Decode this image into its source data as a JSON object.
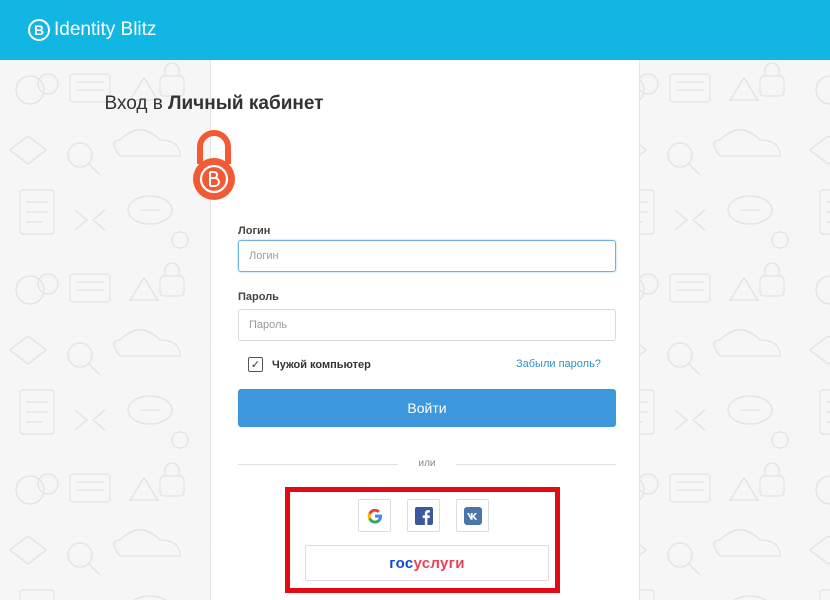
{
  "app": {
    "brand_mark": "B",
    "brand_name": "Identity Blitz"
  },
  "login": {
    "title_prefix": "Вход в",
    "title_bold": "Личный кабинет",
    "login_label": "Логин",
    "login_placeholder": "Логин",
    "password_label": "Пароль",
    "password_placeholder": "Пароль",
    "remember_label": "Чужой компьютер",
    "remember_checked": true,
    "forgot_link": "Забыли пароль?",
    "submit_label": "Войти",
    "separator": "или"
  },
  "social": {
    "providers": [
      "google",
      "facebook",
      "vk"
    ],
    "gosuslugi_a": "гос",
    "gosuslugi_b": "услуги"
  },
  "colors": {
    "header": "#12b6e2",
    "lock": "#f25a35",
    "button": "#3d97dc",
    "highlight": "#e50914",
    "link": "#2f8fcf"
  },
  "icons": {
    "brand": "brand-logo-icon",
    "lock": "padlock-icon",
    "check": "checkmark-icon",
    "google": "google-icon",
    "facebook": "facebook-icon",
    "vk": "vk-icon"
  }
}
